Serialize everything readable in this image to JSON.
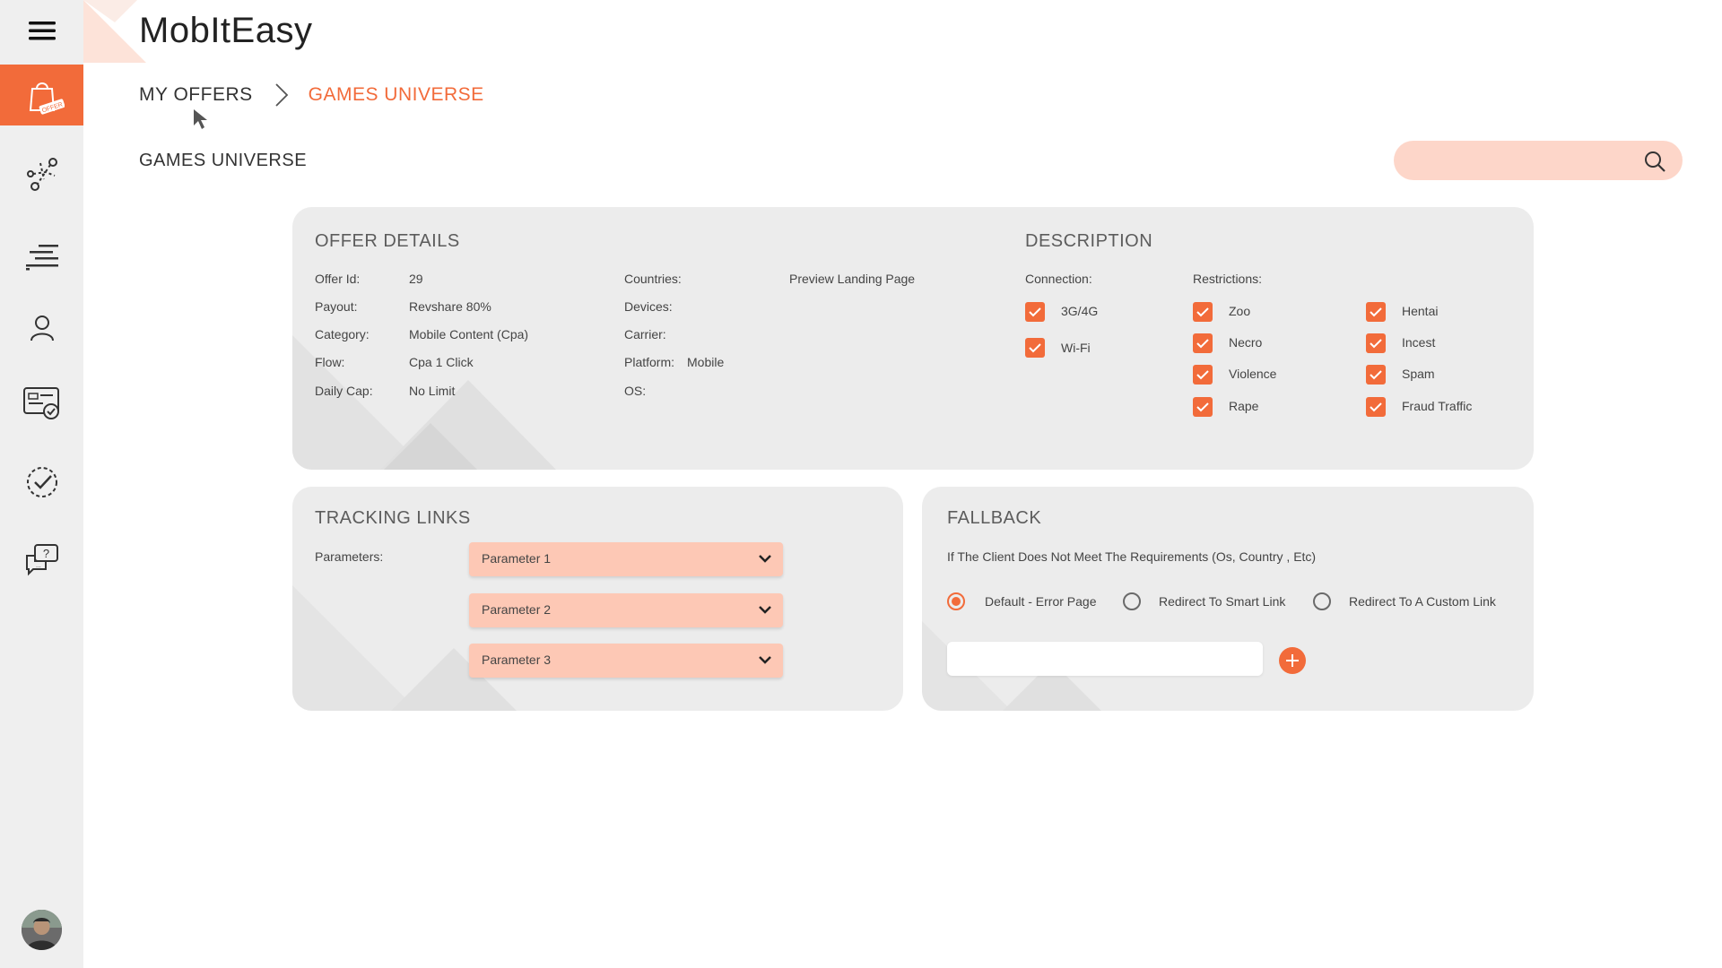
{
  "app": {
    "title": "MobItEasy"
  },
  "sidebar": {
    "items": [
      {
        "icon": "shopping-bag-icon",
        "badge": "OFFER",
        "active": true
      },
      {
        "icon": "network-icon"
      },
      {
        "icon": "bars-icon"
      },
      {
        "icon": "user-icon"
      },
      {
        "icon": "id-card-check-icon"
      },
      {
        "icon": "dashed-check-circle-icon"
      },
      {
        "icon": "question-chat-icon"
      }
    ]
  },
  "breadcrumb": {
    "parent": "MY OFFERS",
    "current": "GAMES UNIVERSE"
  },
  "page": {
    "title": "GAMES UNIVERSE"
  },
  "search": {
    "placeholder": ""
  },
  "offer_details": {
    "title": "OFFER DETAILS",
    "offer_id_label": "Offer Id:",
    "offer_id": "29",
    "payout_label": "Payout:",
    "payout": "Revshare 80%",
    "category_label": "Category:",
    "category": "Mobile Content (Cpa)",
    "flow_label": "Flow:",
    "flow": "Cpa 1 Click",
    "daily_cap_label": "Daily Cap:",
    "daily_cap": "No Limit",
    "countries_label": "Countries:",
    "devices_label": "Devices:",
    "carrier_label": "Carrier:",
    "platform_label": "Platform:",
    "platform": "Mobile",
    "os_label": "OS:",
    "preview_link": "Preview Landing Page"
  },
  "description": {
    "title": "DESCRIPTION",
    "connection_label": "Connection:",
    "connections": [
      "3G/4G",
      "Wi-Fi"
    ],
    "restrictions_label": "Restrictions:",
    "restrictions_col1": [
      "Zoo",
      "Necro",
      "Violence",
      "Rape"
    ],
    "restrictions_col2": [
      "Hentai",
      "Incest",
      "Spam",
      "Fraud Traffic"
    ]
  },
  "tracking": {
    "title": "TRACKING LINKS",
    "parameters_label": "Parameters:",
    "parameters": [
      "Parameter 1",
      "Parameter 2",
      "Parameter 3"
    ]
  },
  "fallback": {
    "title": "FALLBACK",
    "description": "If The Client Does Not Meet The Requirements (Os, Country , Etc)",
    "options": [
      "Default - Error Page",
      "Redirect To Smart Link",
      "Redirect To A Custom Link"
    ],
    "selected": "Default - Error Page",
    "custom_link_value": ""
  },
  "colors": {
    "accent": "#f26b3a",
    "accent_light": "#fdd6c9",
    "card_bg": "#ececec",
    "sidebar_bg": "#efefef"
  }
}
